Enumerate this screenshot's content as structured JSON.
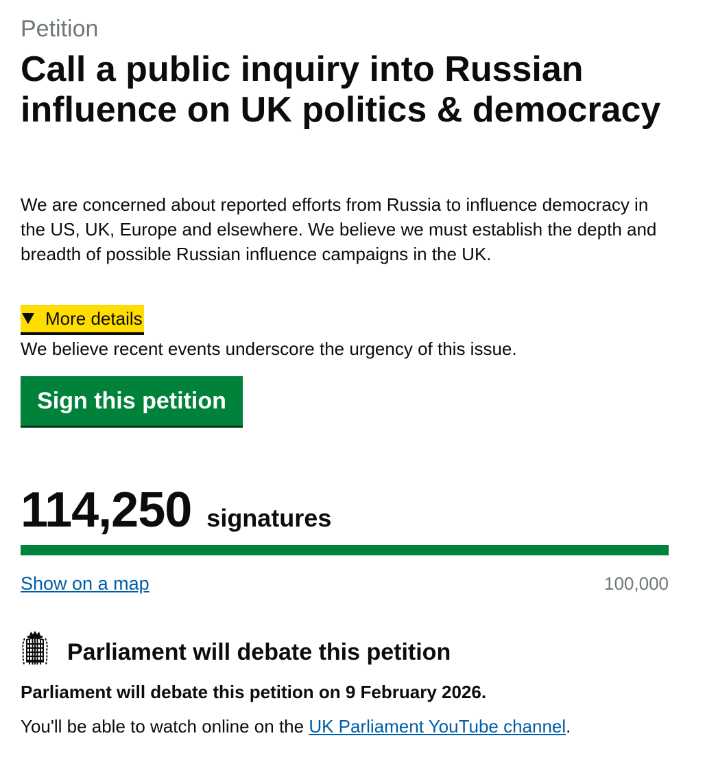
{
  "petition": {
    "caption": "Petition",
    "title": "Call a public inquiry into Russian influence on UK politics & democracy",
    "summary": "We are concerned about reported efforts from Russia to influence democracy in the US, UK, Europe and elsewhere. We believe we must establish the depth and breadth of possible Russian influence campaigns in the UK.",
    "details_toggle_label": "More details",
    "details_text": "We believe recent events underscore the urgency of this issue.",
    "sign_button_label": "Sign this petition"
  },
  "signatures": {
    "count": "114,250",
    "label": "signatures",
    "progress_fraction": 1.0,
    "map_link_label": "Show on a map",
    "threshold": "100,000"
  },
  "debate": {
    "icon": "portcullis-icon",
    "heading": "Parliament will debate this petition",
    "date_text": "Parliament will debate this petition on 9 February 2026.",
    "watch_prefix": "You'll be able to watch online on the ",
    "watch_link_label": "UK Parliament YouTube channel",
    "watch_suffix": "."
  },
  "colors": {
    "sign_button": "#00823b",
    "progress_fill": "#00823b",
    "details_highlight": "#ffdd00",
    "link": "#005ea5",
    "secondary_text": "#6f777b"
  }
}
